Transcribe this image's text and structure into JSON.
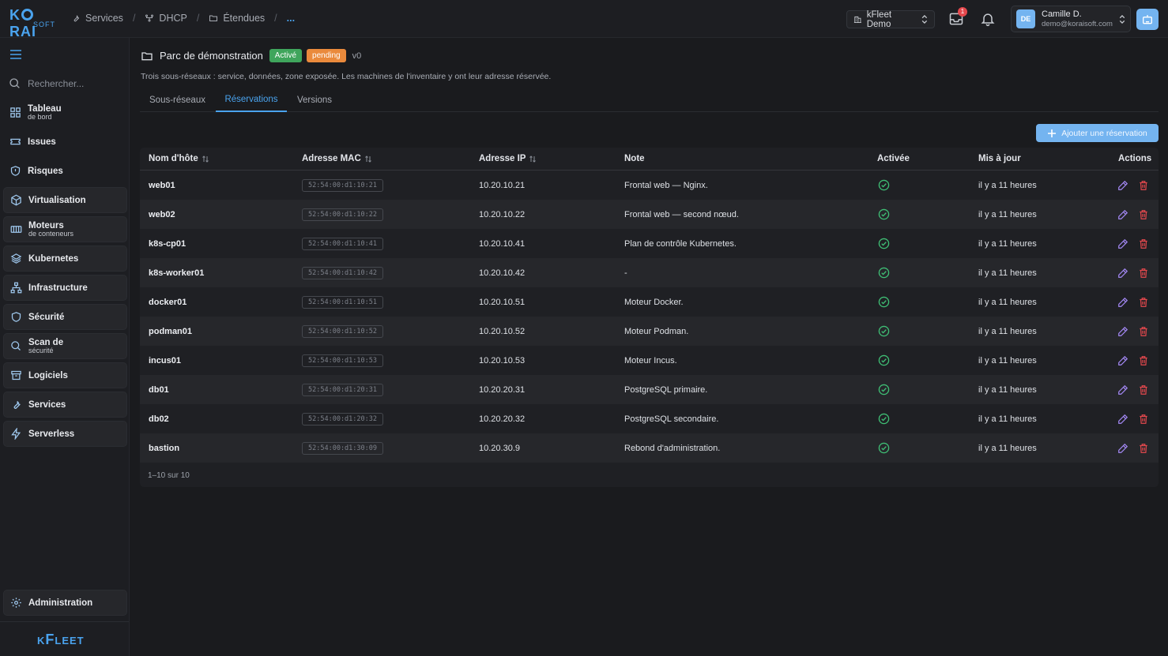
{
  "app": {
    "brand_logo_text": "KORAI",
    "brand_logo_sub": "SOFT",
    "footer_brand": "kFleet"
  },
  "breadcrumb": [
    {
      "label": "Services",
      "icon": "wrench-icon"
    },
    {
      "label": "DHCP",
      "icon": "network-icon"
    },
    {
      "label": "Étendues",
      "icon": "folder-icon"
    },
    {
      "label": "..."
    }
  ],
  "topbar": {
    "org_label": "kFleet Demo",
    "inbox_badge": "1",
    "user_initials": "DE",
    "user_name": "Camille D.",
    "user_email": "demo@koraisoft.com"
  },
  "sidebar": {
    "search_placeholder": "Rechercher...",
    "items": [
      {
        "label": "Tableau",
        "sub": "de bord",
        "icon": "dashboard-icon"
      },
      {
        "label": "Issues",
        "sub": "",
        "icon": "ticket-icon"
      },
      {
        "label": "Risques",
        "sub": "",
        "icon": "shield-alert-icon"
      },
      {
        "label": "Virtualisation",
        "sub": "",
        "icon": "cube-icon"
      },
      {
        "label": "Moteurs",
        "sub": "de conteneurs",
        "icon": "container-icon"
      },
      {
        "label": "Kubernetes",
        "sub": "",
        "icon": "layers-icon"
      },
      {
        "label": "Infrastructure",
        "sub": "",
        "icon": "network-tree-icon"
      },
      {
        "label": "Sécurité",
        "sub": "",
        "icon": "shield-icon"
      },
      {
        "label": "Scan de",
        "sub": "sécurité",
        "icon": "scan-icon"
      },
      {
        "label": "Logiciels",
        "sub": "",
        "icon": "package-icon"
      },
      {
        "label": "Services",
        "sub": "",
        "icon": "wrench-icon"
      },
      {
        "label": "Serverless",
        "sub": "",
        "icon": "bolt-icon"
      }
    ],
    "admin_label": "Administration"
  },
  "page": {
    "title": "Parc de démonstration",
    "status_tag": "Activé",
    "state_tag": "pending",
    "version": "v0",
    "description": "Trois sous-réseaux : service, données, zone exposée. Les machines de l'inventaire y ont leur adresse réservée.",
    "tabs": [
      "Sous-réseaux",
      "Réservations",
      "Versions"
    ],
    "active_tab": "Réservations",
    "add_button": "Ajouter une réservation"
  },
  "table": {
    "columns": [
      "Nom d'hôte",
      "Adresse MAC",
      "Adresse IP",
      "Note",
      "Activée",
      "Mis à jour",
      "Actions"
    ],
    "rows": [
      {
        "host": "web01",
        "mac": "52:54:00:d1:10:21",
        "ip": "10.20.10.21",
        "note": "Frontal web — Nginx.",
        "enabled": true,
        "updated": "il y a 11 heures"
      },
      {
        "host": "web02",
        "mac": "52:54:00:d1:10:22",
        "ip": "10.20.10.22",
        "note": "Frontal web — second nœud.",
        "enabled": true,
        "updated": "il y a 11 heures"
      },
      {
        "host": "k8s-cp01",
        "mac": "52:54:00:d1:10:41",
        "ip": "10.20.10.41",
        "note": "Plan de contrôle Kubernetes.",
        "enabled": true,
        "updated": "il y a 11 heures"
      },
      {
        "host": "k8s-worker01",
        "mac": "52:54:00:d1:10:42",
        "ip": "10.20.10.42",
        "note": "-",
        "enabled": true,
        "updated": "il y a 11 heures"
      },
      {
        "host": "docker01",
        "mac": "52:54:00:d1:10:51",
        "ip": "10.20.10.51",
        "note": "Moteur Docker.",
        "enabled": true,
        "updated": "il y a 11 heures"
      },
      {
        "host": "podman01",
        "mac": "52:54:00:d1:10:52",
        "ip": "10.20.10.52",
        "note": "Moteur Podman.",
        "enabled": true,
        "updated": "il y a 11 heures"
      },
      {
        "host": "incus01",
        "mac": "52:54:00:d1:10:53",
        "ip": "10.20.10.53",
        "note": "Moteur Incus.",
        "enabled": true,
        "updated": "il y a 11 heures"
      },
      {
        "host": "db01",
        "mac": "52:54:00:d1:20:31",
        "ip": "10.20.20.31",
        "note": "PostgreSQL primaire.",
        "enabled": true,
        "updated": "il y a 11 heures"
      },
      {
        "host": "db02",
        "mac": "52:54:00:d1:20:32",
        "ip": "10.20.20.32",
        "note": "PostgreSQL secondaire.",
        "enabled": true,
        "updated": "il y a 11 heures"
      },
      {
        "host": "bastion",
        "mac": "52:54:00:d1:30:09",
        "ip": "10.20.30.9",
        "note": "Rebond d'administration.",
        "enabled": true,
        "updated": "il y a 11 heures"
      }
    ],
    "pagination": "1–10 sur 10"
  },
  "colors": {
    "accent": "#4aa3ee",
    "success": "#3fa55c",
    "warning": "#ea8a3c",
    "edit_icon": "#a78bfa",
    "delete_icon": "#e5484d",
    "check_icon": "#3fbf75"
  }
}
